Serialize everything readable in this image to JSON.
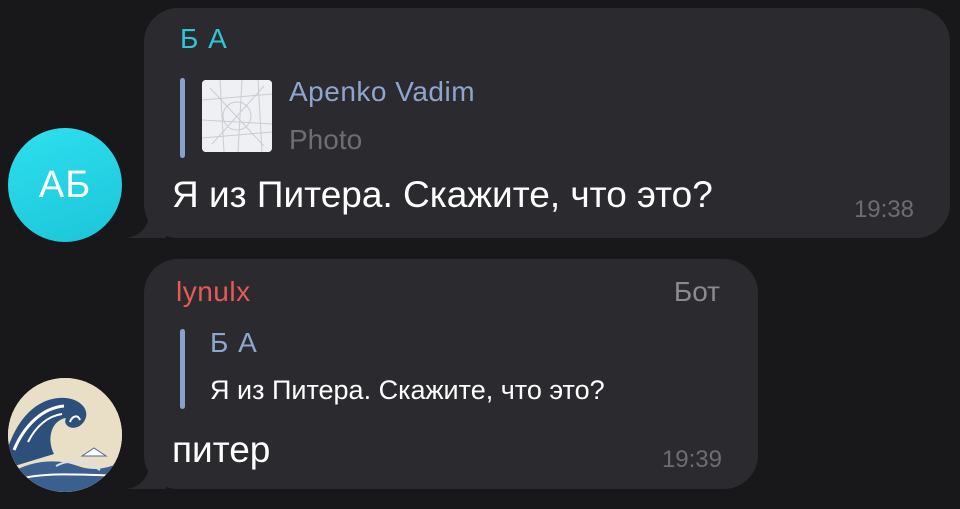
{
  "messages": [
    {
      "avatar_initials": "АБ",
      "avatar_color": "#2fe0ee",
      "sender": "Б А",
      "sender_color": "#2fc6d3",
      "reply": {
        "name": "Apenko Vadim",
        "text": "Photo",
        "thumbnail_icon": "map-thumbnail"
      },
      "text": "Я из Питера. Скажите, что это?",
      "time": "19:38"
    },
    {
      "avatar_icon": "wave-painting-avatar",
      "sender": "lynulx",
      "sender_color": "#e85a55",
      "tag": "Бот",
      "reply": {
        "name": "Б А",
        "text": "Я из Питера. Скажите, что это?"
      },
      "text": "питер",
      "time": "19:39"
    }
  ],
  "colors": {
    "background": "#18181a",
    "bubble": "#2b2b2f",
    "reply_accent": "#8aa1c9",
    "muted_text": "#6d6d72"
  }
}
